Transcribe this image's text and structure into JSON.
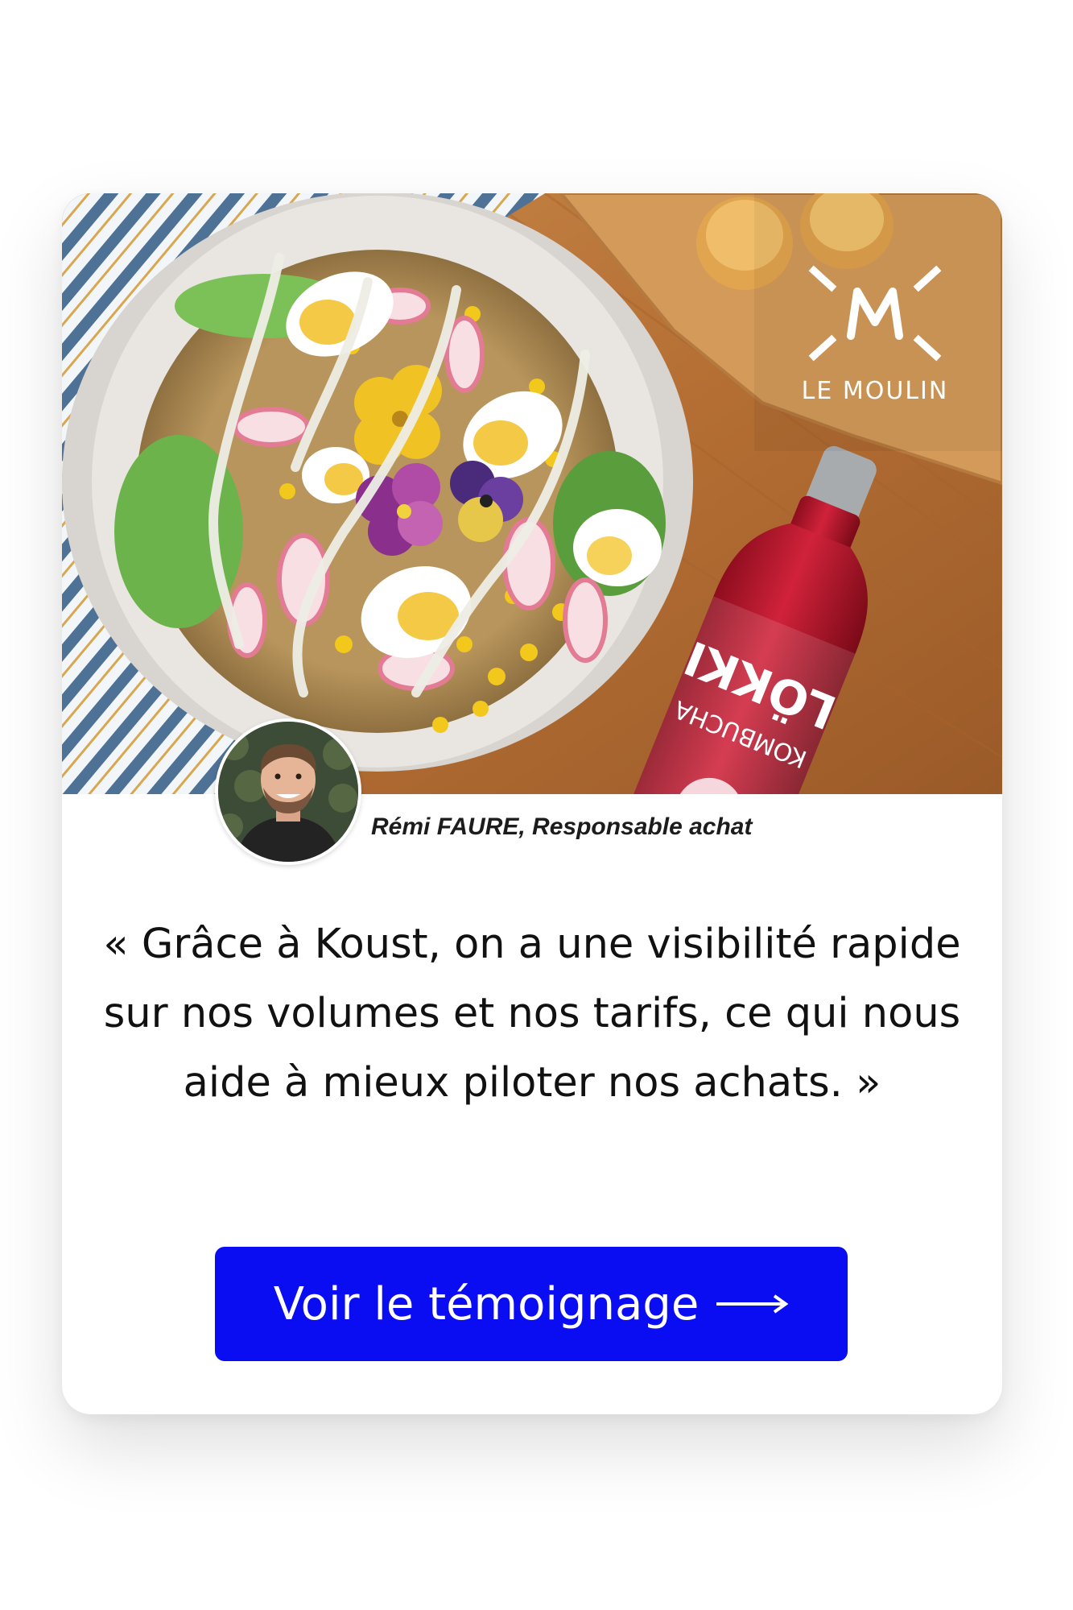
{
  "card": {
    "brand": {
      "name": "LE MOULIN"
    },
    "testimonial": {
      "author": "Rémi FAURE, Responsable achat",
      "quote": "« Grâce à Koust, on a une visibilité rapide sur nos volumes et nos tarifs, ce qui nous aide à mieux piloter nos achats. »"
    },
    "cta": {
      "label": "Voir le témoignage",
      "icon": "arrow-right-icon"
    }
  },
  "colors": {
    "accent": "#0a0cf2",
    "card_background": "#ffffff",
    "text": "#111111"
  }
}
